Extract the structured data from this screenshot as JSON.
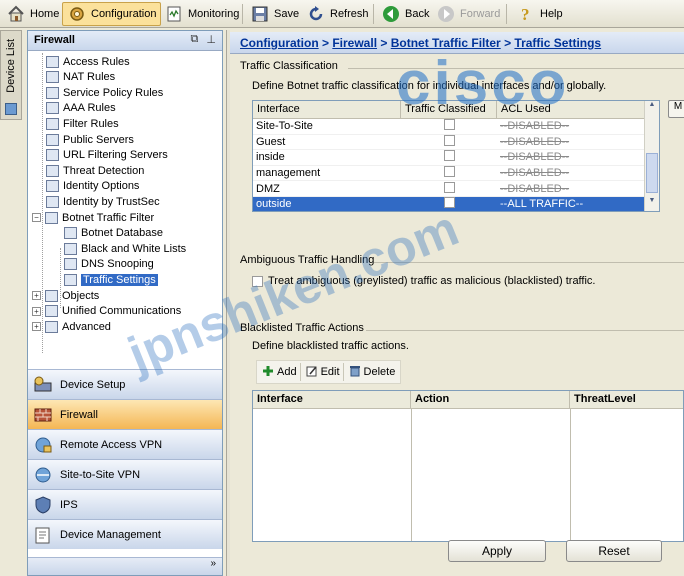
{
  "toolbar": {
    "home": "Home",
    "configuration": "Configuration",
    "monitoring": "Monitoring",
    "save": "Save",
    "refresh": "Refresh",
    "back": "Back",
    "forward": "Forward",
    "help": "Help"
  },
  "device_list": {
    "label": "Device List"
  },
  "nav": {
    "title": "Firewall",
    "tree": [
      {
        "label": "Access Rules",
        "icon": "access-rules-icon"
      },
      {
        "label": "NAT Rules",
        "icon": "nat-rules-icon"
      },
      {
        "label": "Service Policy Rules",
        "icon": "service-policy-icon"
      },
      {
        "label": "AAA Rules",
        "icon": "aaa-rules-icon"
      },
      {
        "label": "Filter Rules",
        "icon": "filter-rules-icon"
      },
      {
        "label": "Public Servers",
        "icon": "public-servers-icon"
      },
      {
        "label": "URL Filtering Servers",
        "icon": "url-filtering-icon"
      },
      {
        "label": "Threat Detection",
        "icon": "threat-detection-icon"
      },
      {
        "label": "Identity Options",
        "icon": "identity-options-icon"
      },
      {
        "label": "Identity by TrustSec",
        "icon": "trustsec-icon"
      },
      {
        "label": "Botnet Traffic Filter",
        "icon": "botnet-filter-icon"
      },
      {
        "label": "Botnet Database",
        "icon": "botnet-database-icon"
      },
      {
        "label": "Black and White Lists",
        "icon": "lists-icon"
      },
      {
        "label": "DNS Snooping",
        "icon": "dns-snooping-icon"
      },
      {
        "label": "Traffic Settings",
        "icon": "traffic-settings-icon"
      },
      {
        "label": "Objects",
        "icon": "objects-icon"
      },
      {
        "label": "Unified Communications",
        "icon": "unified-comm-icon"
      },
      {
        "label": "Advanced",
        "icon": "advanced-icon"
      }
    ],
    "buttons": [
      {
        "label": "Device Setup",
        "icon": "device-setup-icon"
      },
      {
        "label": "Firewall",
        "icon": "firewall-icon"
      },
      {
        "label": "Remote Access VPN",
        "icon": "remote-access-vpn-icon"
      },
      {
        "label": "Site-to-Site VPN",
        "icon": "site-to-site-vpn-icon"
      },
      {
        "label": "IPS",
        "icon": "ips-icon"
      },
      {
        "label": "Device Management",
        "icon": "device-management-icon"
      }
    ],
    "more": "»"
  },
  "breadcrumb": {
    "part1": "Configuration",
    "sep": " > ",
    "part2": "Firewall",
    "part3": "Botnet Traffic Filter",
    "part4": "Traffic Settings"
  },
  "traffic_classification": {
    "title": "Traffic Classification",
    "description": "Define Botnet traffic classification for individual interfaces and/or globally.",
    "columns": [
      "Interface",
      "Traffic Classified",
      "ACL Used"
    ],
    "rows": [
      {
        "interface": "Site-To-Site",
        "classified": false,
        "acl": "--DISABLED--"
      },
      {
        "interface": "Guest",
        "classified": false,
        "acl": "--DISABLED--"
      },
      {
        "interface": "inside",
        "classified": false,
        "acl": "--DISABLED--"
      },
      {
        "interface": "management",
        "classified": false,
        "acl": "--DISABLED--"
      },
      {
        "interface": "DMZ",
        "classified": false,
        "acl": "--DISABLED--"
      },
      {
        "interface": "outside",
        "classified": false,
        "acl": "--ALL TRAFFIC--"
      }
    ],
    "side_button": "M"
  },
  "ambiguous": {
    "title": "Ambiguous Traffic Handling",
    "checkbox_label": "Treat ambiguous (greylisted) traffic as malicious (blacklisted) traffic."
  },
  "blacklisted": {
    "title": "Blacklisted Traffic Actions",
    "description": "Define blacklisted traffic actions.",
    "add": "Add",
    "edit": "Edit",
    "delete": "Delete",
    "columns": [
      "Interface",
      "Action",
      "ThreatLevel"
    ]
  },
  "footer": {
    "apply": "Apply",
    "reset": "Reset"
  },
  "watermarks": {
    "cisco": "cisco",
    "site": "jpnshiken.com"
  }
}
